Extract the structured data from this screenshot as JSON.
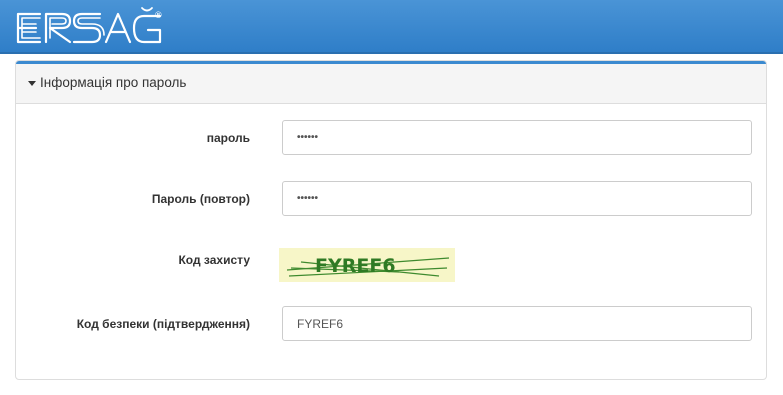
{
  "header": {
    "logo_text": "ERSAĞ®",
    "brand_color": "#3a88d0"
  },
  "panel": {
    "title": "Інформація про пароль",
    "caret_icon": "caret-down-icon"
  },
  "fields": {
    "password": {
      "label": "пароль",
      "value": "••••••"
    },
    "password_repeat": {
      "label": "Пароль (повтор)",
      "value": "••••••"
    },
    "captcha": {
      "label": "Код захисту",
      "code": "FYREF6"
    },
    "captcha_confirm": {
      "label": "Код безпеки (підтвердження)",
      "value": "FYREF6"
    }
  }
}
